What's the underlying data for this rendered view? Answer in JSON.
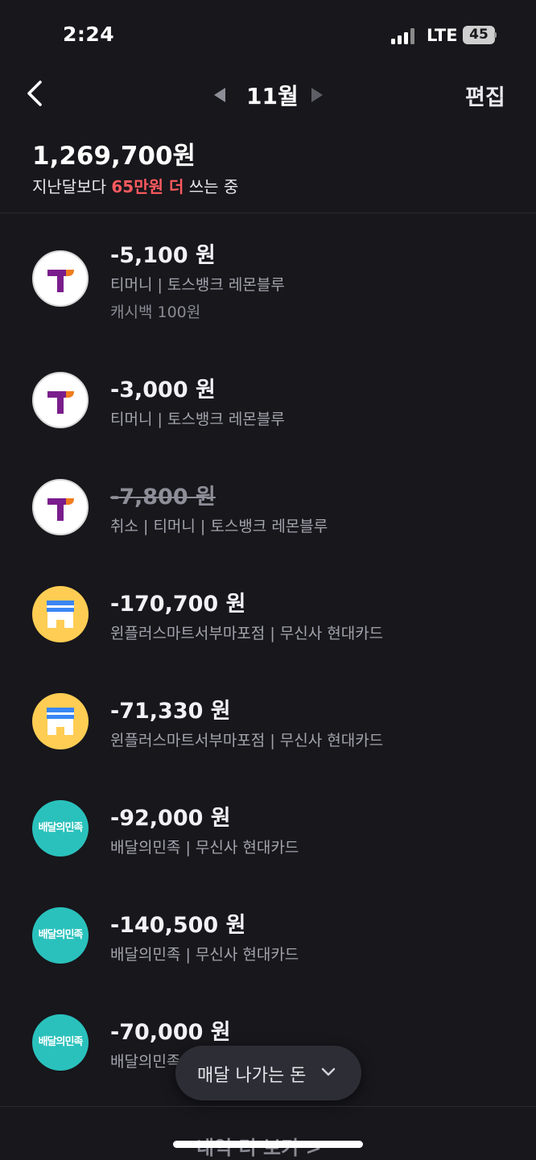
{
  "status_bar": {
    "time": "2:24",
    "network": "LTE",
    "battery": "45"
  },
  "header": {
    "month": "11월",
    "edit_label": "편집"
  },
  "summary": {
    "total": "1,269,700원",
    "compare_prefix": "지난달보다 ",
    "compare_highlight": "65만원 더",
    "compare_suffix": " 쓰는 중"
  },
  "transactions": [
    {
      "icon": "tmoney-icon",
      "amount": "-5,100 원",
      "desc": "티머니 | 토스뱅크 레몬블루",
      "sub": "캐시백 100원",
      "cancelled": false
    },
    {
      "icon": "tmoney-icon",
      "amount": "-3,000 원",
      "desc": "티머니 | 토스뱅크 레몬블루",
      "cancelled": false
    },
    {
      "icon": "tmoney-icon",
      "amount": "-7,800 원",
      "desc": "취소 | 티머니 | 토스뱅크 레몬블루",
      "cancelled": true
    },
    {
      "icon": "store-icon",
      "amount": "-170,700 원",
      "desc": "윈플러스마트서부마포점 | 무신사 현대카드",
      "cancelled": false
    },
    {
      "icon": "store-icon",
      "amount": "-71,330 원",
      "desc": "윈플러스마트서부마포점 | 무신사 현대카드",
      "cancelled": false
    },
    {
      "icon": "baemin-icon",
      "icon_text": "배달의민족",
      "amount": "-92,000 원",
      "desc": "배달의민족 | 무신사 현대카드",
      "cancelled": false
    },
    {
      "icon": "baemin-icon",
      "icon_text": "배달의민족",
      "amount": "-140,500 원",
      "desc": "배달의민족 | 무신사 현대카드",
      "cancelled": false
    },
    {
      "icon": "baemin-icon",
      "icon_text": "배달의민족",
      "amount": "-70,000 원",
      "desc": "배달의민족",
      "cancelled": false
    }
  ],
  "floating_button": {
    "label": "매달 나가는 돈"
  },
  "footer": {
    "more_label": "내역 더 보기 >"
  },
  "colors": {
    "background": "#17171c",
    "highlight": "#ff5a5f",
    "baemin": "#2ac1bc",
    "store": "#ffcd53"
  }
}
